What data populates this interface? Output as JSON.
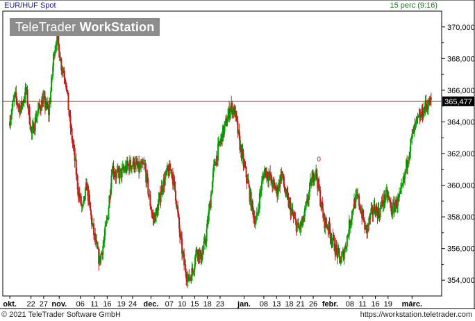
{
  "header": {
    "symbol": "EUR/HUF Spot",
    "interval": "15 perc (9:16)"
  },
  "watermark": {
    "brand": "TeleTrader",
    "product": "WorkStation"
  },
  "footer": {
    "copyright": "© 2021 TeleTrader Software GmbH",
    "website": "https://workstation.teletrader.com"
  },
  "chart_data": {
    "type": "candlestick",
    "ylim": [
      353.0,
      371.0
    ],
    "y_ticks": [
      354,
      356,
      358,
      360,
      362,
      364,
      366,
      368,
      370
    ],
    "y_tick_labels": [
      "354,000",
      "356,000",
      "358,000",
      "360,000",
      "362,000",
      "364,000",
      "366,000",
      "368,000",
      "370,000"
    ],
    "x_ticks": [
      {
        "label": "okt.",
        "pos": 0.0
      },
      {
        "label": "22",
        "pos": 1.5
      },
      {
        "label": "27",
        "pos": 2.4
      },
      {
        "label": "nov.",
        "pos": 3.5
      },
      {
        "label": "06",
        "pos": 5.0
      },
      {
        "label": "11",
        "pos": 6.0
      },
      {
        "label": "16",
        "pos": 6.9
      },
      {
        "label": "19",
        "pos": 7.9
      },
      {
        "label": "24",
        "pos": 8.7
      },
      {
        "label": "dec.",
        "pos": 10.0
      },
      {
        "label": "07",
        "pos": 11.3
      },
      {
        "label": "10",
        "pos": 12.2
      },
      {
        "label": "15",
        "pos": 13.1
      },
      {
        "label": "18",
        "pos": 14.0
      },
      {
        "label": "23",
        "pos": 14.9
      },
      {
        "label": "jan.",
        "pos": 16.6
      },
      {
        "label": "08",
        "pos": 18.0
      },
      {
        "label": "13",
        "pos": 18.9
      },
      {
        "label": "18",
        "pos": 19.8
      },
      {
        "label": "21",
        "pos": 20.6
      },
      {
        "label": "26",
        "pos": 21.5
      },
      {
        "label": "febr.",
        "pos": 22.7
      },
      {
        "label": "08",
        "pos": 24.1
      },
      {
        "label": "11",
        "pos": 25.0
      },
      {
        "label": "16",
        "pos": 25.9
      },
      {
        "label": "19",
        "pos": 26.8
      },
      {
        "label": "márc.",
        "pos": 28.5
      }
    ],
    "x_range": [
      -0.5,
      30.6
    ],
    "price_path": [
      [
        0.0,
        364.0
      ],
      [
        0.4,
        365.6
      ],
      [
        0.8,
        364.8
      ],
      [
        1.2,
        366.0
      ],
      [
        1.6,
        363.2
      ],
      [
        2.0,
        364.6
      ],
      [
        2.4,
        365.4
      ],
      [
        2.8,
        364.6
      ],
      [
        3.0,
        366.4
      ],
      [
        3.2,
        368.6
      ],
      [
        3.4,
        369.4
      ],
      [
        3.7,
        367.6
      ],
      [
        4.0,
        366.8
      ],
      [
        4.3,
        364.0
      ],
      [
        4.6,
        362.0
      ],
      [
        4.9,
        359.6
      ],
      [
        5.2,
        358.4
      ],
      [
        5.5,
        360.0
      ],
      [
        5.8,
        358.0
      ],
      [
        6.1,
        356.4
      ],
      [
        6.4,
        355.2
      ],
      [
        6.7,
        356.4
      ],
      [
        7.0,
        358.2
      ],
      [
        7.3,
        361.2
      ],
      [
        7.6,
        360.6
      ],
      [
        8.0,
        360.8
      ],
      [
        8.4,
        361.2
      ],
      [
        8.8,
        361.4
      ],
      [
        9.2,
        361.0
      ],
      [
        9.6,
        361.2
      ],
      [
        9.9,
        359.4
      ],
      [
        10.2,
        357.8
      ],
      [
        10.5,
        358.4
      ],
      [
        10.8,
        359.8
      ],
      [
        11.2,
        360.8
      ],
      [
        11.5,
        361.0
      ],
      [
        11.8,
        359.4
      ],
      [
        12.1,
        356.8
      ],
      [
        12.4,
        355.0
      ],
      [
        12.7,
        354.0
      ],
      [
        13.0,
        354.6
      ],
      [
        13.3,
        356.0
      ],
      [
        13.6,
        355.4
      ],
      [
        13.9,
        356.4
      ],
      [
        14.2,
        358.6
      ],
      [
        14.5,
        361.0
      ],
      [
        14.8,
        362.2
      ],
      [
        15.1,
        363.2
      ],
      [
        15.4,
        364.0
      ],
      [
        15.7,
        365.0
      ],
      [
        16.0,
        364.6
      ],
      [
        16.3,
        362.8
      ],
      [
        16.6,
        361.4
      ],
      [
        16.9,
        360.2
      ],
      [
        17.2,
        358.6
      ],
      [
        17.5,
        357.6
      ],
      [
        17.8,
        359.6
      ],
      [
        18.1,
        361.0
      ],
      [
        18.4,
        360.6
      ],
      [
        18.7,
        360.0
      ],
      [
        19.0,
        359.6
      ],
      [
        19.3,
        360.8
      ],
      [
        19.6,
        359.4
      ],
      [
        19.9,
        358.6
      ],
      [
        20.2,
        357.8
      ],
      [
        20.5,
        357.2
      ],
      [
        20.8,
        357.6
      ],
      [
        21.1,
        358.8
      ],
      [
        21.4,
        360.2
      ],
      [
        21.7,
        361.0
      ],
      [
        22.0,
        359.4
      ],
      [
        22.3,
        357.8
      ],
      [
        22.6,
        357.4
      ],
      [
        22.9,
        356.6
      ],
      [
        23.2,
        355.8
      ],
      [
        23.5,
        355.2
      ],
      [
        23.8,
        356.0
      ],
      [
        24.1,
        357.4
      ],
      [
        24.4,
        358.8
      ],
      [
        24.7,
        359.2
      ],
      [
        25.0,
        358.2
      ],
      [
        25.3,
        357.0
      ],
      [
        25.6,
        358.0
      ],
      [
        25.9,
        358.6
      ],
      [
        26.2,
        358.2
      ],
      [
        26.5,
        359.0
      ],
      [
        26.8,
        359.4
      ],
      [
        27.1,
        358.4
      ],
      [
        27.4,
        358.8
      ],
      [
        27.7,
        359.2
      ],
      [
        28.0,
        360.4
      ],
      [
        28.3,
        362.0
      ],
      [
        28.6,
        363.2
      ],
      [
        28.9,
        364.0
      ],
      [
        29.2,
        364.4
      ],
      [
        29.5,
        365.0
      ],
      [
        29.9,
        365.3
      ]
    ],
    "reference_line": 365.3,
    "last_value_label": "365,477",
    "marker_label": "0",
    "marker_point": [
      21.9,
      361.5
    ],
    "colors": {
      "up": "#00a000",
      "down": "#c41a1a",
      "reference": "#cc0000",
      "axis": "#000000",
      "grid": "#d8d8d8",
      "marker": "#e01010"
    }
  }
}
